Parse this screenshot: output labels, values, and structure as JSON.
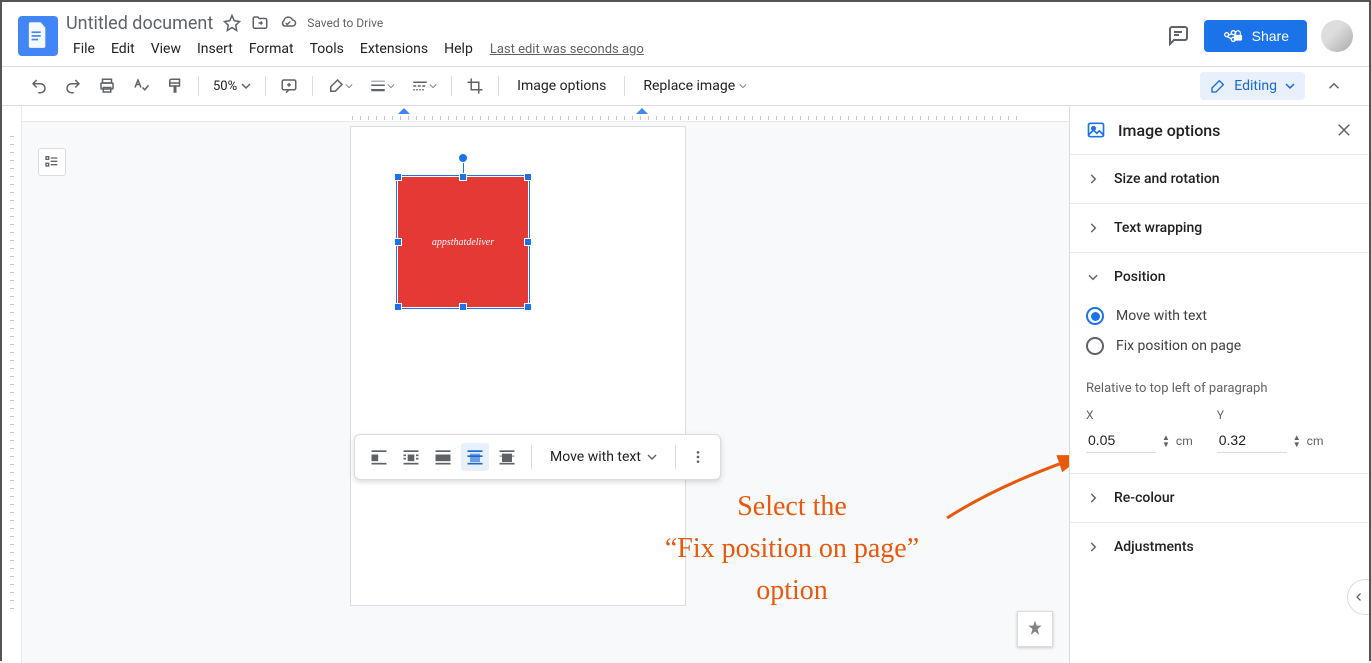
{
  "header": {
    "doc_title": "Untitled document",
    "saved_text": "Saved to Drive",
    "last_edit": "Last edit was seconds ago",
    "share_label": "Share"
  },
  "menus": [
    "File",
    "Edit",
    "View",
    "Insert",
    "Format",
    "Tools",
    "Extensions",
    "Help"
  ],
  "toolbar": {
    "zoom": "50%",
    "image_options": "Image options",
    "replace_image": "Replace image",
    "editing": "Editing"
  },
  "image_toolbar": {
    "move_mode": "Move with text"
  },
  "image_text": "appsthatdeliver",
  "annotation": {
    "line1": "Select the",
    "line2": "“Fix position on page”",
    "line3": "option"
  },
  "sidebar": {
    "title": "Image options",
    "sections": {
      "size_rotation": "Size and rotation",
      "text_wrapping": "Text wrapping",
      "position": "Position",
      "recolour": "Re-colour",
      "adjustments": "Adjustments"
    },
    "position_panel": {
      "radio_move": "Move with text",
      "radio_fix": "Fix position on page",
      "relative_label": "Relative to top left of paragraph",
      "x_label": "X",
      "y_label": "Y",
      "x_value": "0.05",
      "y_value": "0.32",
      "unit": "cm"
    }
  }
}
